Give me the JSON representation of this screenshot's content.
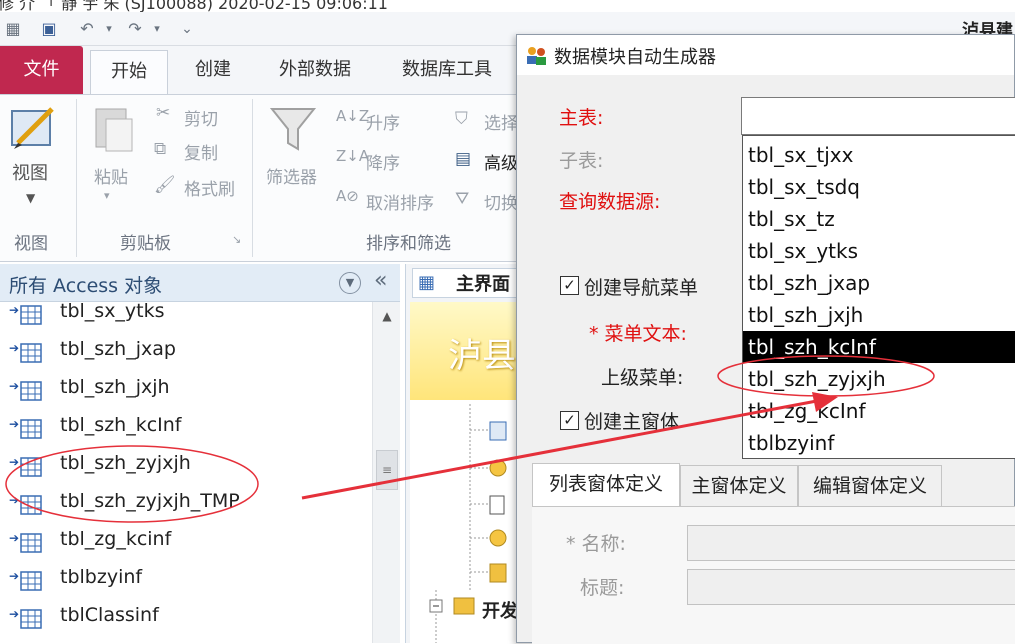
{
  "caption": "修 介 「 静 宇 朱 (SJ100088)  2020-02-15  09:06:11 ",
  "app_title_right": "泸县建",
  "ribbon": {
    "tabs": [
      "文件",
      "开始",
      "创建",
      "外部数据",
      "数据库工具"
    ],
    "view_label": "视图",
    "paste_label": "粘贴",
    "cut_label": "剪切",
    "copy_label": "复制",
    "format_painter_label": "格式刷",
    "filter_label": "筛选器",
    "sort_asc_label": "升序",
    "sort_desc_label": "降序",
    "clear_sort_label": "取消排序",
    "select_label": "选择",
    "advanced_label": "高级",
    "toggle_filter_label": "切换",
    "group_view": "视图",
    "group_clipboard": "剪贴板",
    "group_sort_filter": "排序和筛选"
  },
  "nav": {
    "title": "所有 Access 对象",
    "items": [
      "tbl_sx_ytks",
      "tbl_szh_jxap",
      "tbl_szh_jxjh",
      "tbl_szh_kcInf",
      "tbl_szh_zyjxjh",
      "tbl_szh_zyjxjh_TMP",
      "tbl_zg_kcinf",
      "tblbzyinf",
      "tblClassinf"
    ]
  },
  "main": {
    "tab_label": "主界面",
    "banner_text": "泸县",
    "tree_node": "开发"
  },
  "dialog": {
    "title": "数据模块自动生成器",
    "main_table_label": "主表:",
    "sub_table_label": "子表:",
    "query_source_label": "查询数据源:",
    "create_nav_menu_label": "创建导航菜单",
    "menu_text_label": "* 菜单文本:",
    "parent_menu_label": "上级菜单:",
    "create_main_form_label": "创建主窗体",
    "dropdown_items": [
      "tbl_sx_tjxx",
      "tbl_sx_tsdq",
      "tbl_sx_tz",
      "tbl_sx_ytks",
      "tbl_szh_jxap",
      "tbl_szh_jxjh",
      "tbl_szh_kcInf",
      "tbl_szh_zyjxjh",
      "tbl_zg_kcInf",
      "tblbzyinf"
    ],
    "selected_item": "tbl_szh_kcInf",
    "tabs": [
      "列表窗体定义",
      "主窗体定义",
      "编辑窗体定义"
    ],
    "name_label": "* 名称:",
    "caption_label": "标题:",
    "create_nav_menu_checked": true,
    "create_main_form_checked": true
  },
  "colors": {
    "file_tab": "#c0284f",
    "required_label": "#e01010",
    "annotation": "#e5303a"
  }
}
